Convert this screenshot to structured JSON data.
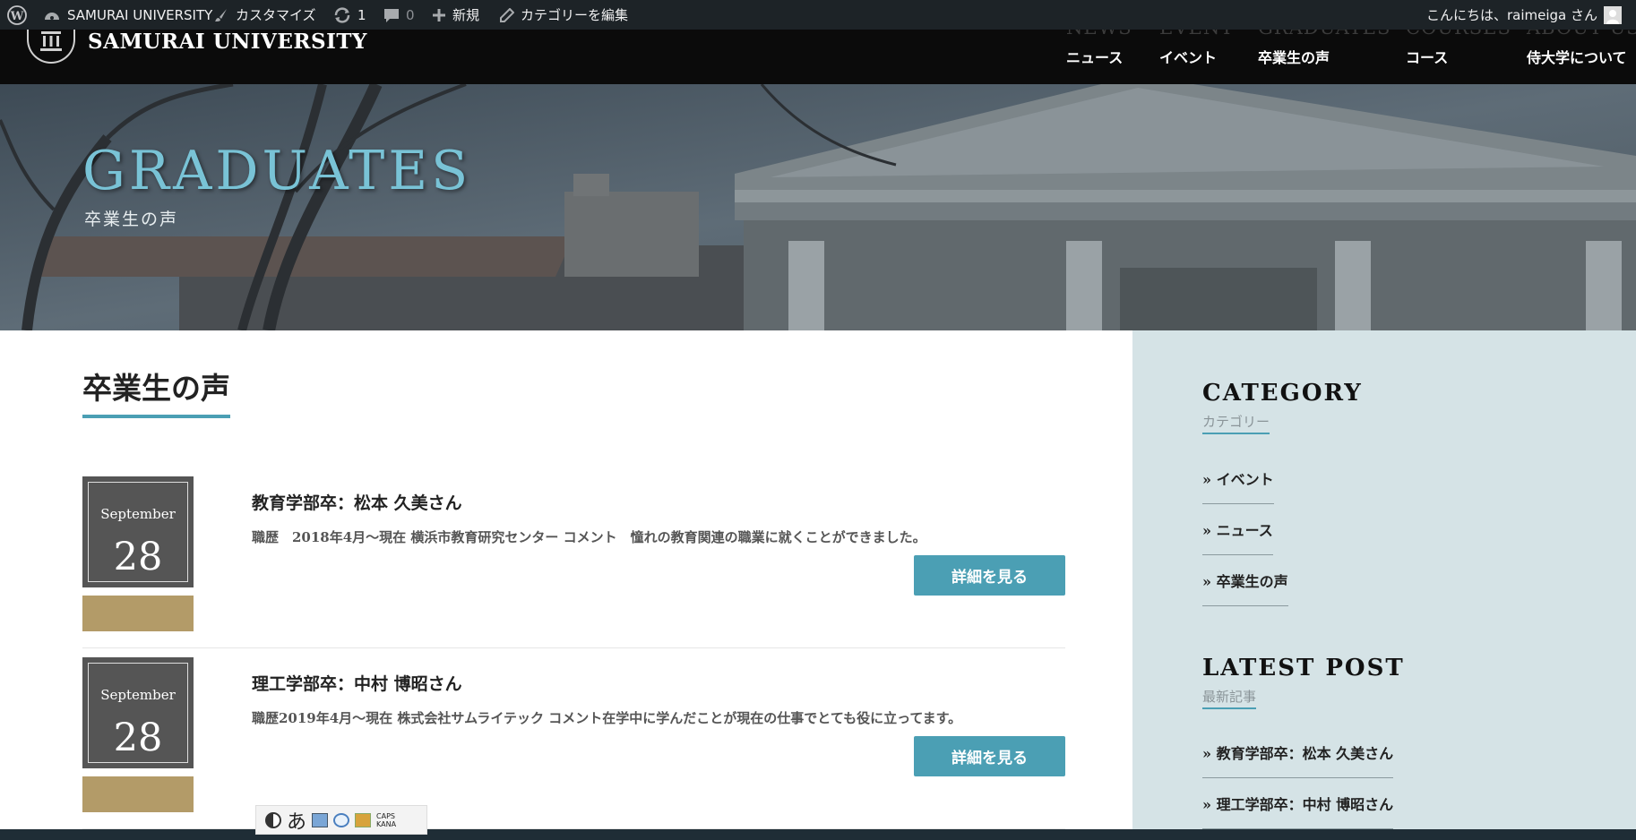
{
  "admin_bar": {
    "site_name": "SAMURAI UNIVERSITY",
    "customize": "カスタマイズ",
    "updates_count": "1",
    "comments_count": "0",
    "new_label": "新規",
    "edit_category": "カテゴリーを編集",
    "greeting": "こんにちは、raimeiga さん"
  },
  "header": {
    "site_title": "SAMURAI UNIVERSITY",
    "nav": [
      {
        "en": "NEWS",
        "ja": "ニュース"
      },
      {
        "en": "EVENT",
        "ja": "イベント"
      },
      {
        "en": "GRADUATES",
        "ja": "卒業生の声"
      },
      {
        "en": "COURSES",
        "ja": "コース"
      },
      {
        "en": "ABOUT US",
        "ja": "侍大学について"
      }
    ]
  },
  "hero": {
    "title": "GRADUATES",
    "subtitle": "卒業生の声"
  },
  "main": {
    "heading": "卒業生の声",
    "posts": [
      {
        "month": "September",
        "day": "28",
        "title": "教育学部卒：松本 久美さん",
        "excerpt": "職歴　2018年4月～現在 横浜市教育研究センター コメント　憧れの教育関連の職業に就くことができました。",
        "button": "詳細を見る"
      },
      {
        "month": "September",
        "day": "28",
        "title": "理工学部卒：中村 博昭さん",
        "excerpt": "職歴2019年4月～現在 株式会社サムライテック コメント在学中に学んだことが現在の仕事でとても役に立ってます。",
        "button": "詳細を見る"
      }
    ]
  },
  "sidebar": {
    "category_heading": "CATEGORY",
    "category_sub": "カテゴリー",
    "categories": [
      "イベント",
      "ニュース",
      "卒業生の声"
    ],
    "latest_heading": "LATEST POST",
    "latest_sub": "最新記事",
    "latest": [
      "教育学部卒：松本 久美さん",
      "理工学部卒：中村 博昭さん"
    ]
  },
  "ime": {
    "mode": "あ",
    "caps": "CAPS",
    "kana": "KANA"
  },
  "colors": {
    "accent": "#4b9fb4",
    "category_band": "#b39b68",
    "date_box": "#555555",
    "sidebar_bg": "#d5e3e6"
  }
}
